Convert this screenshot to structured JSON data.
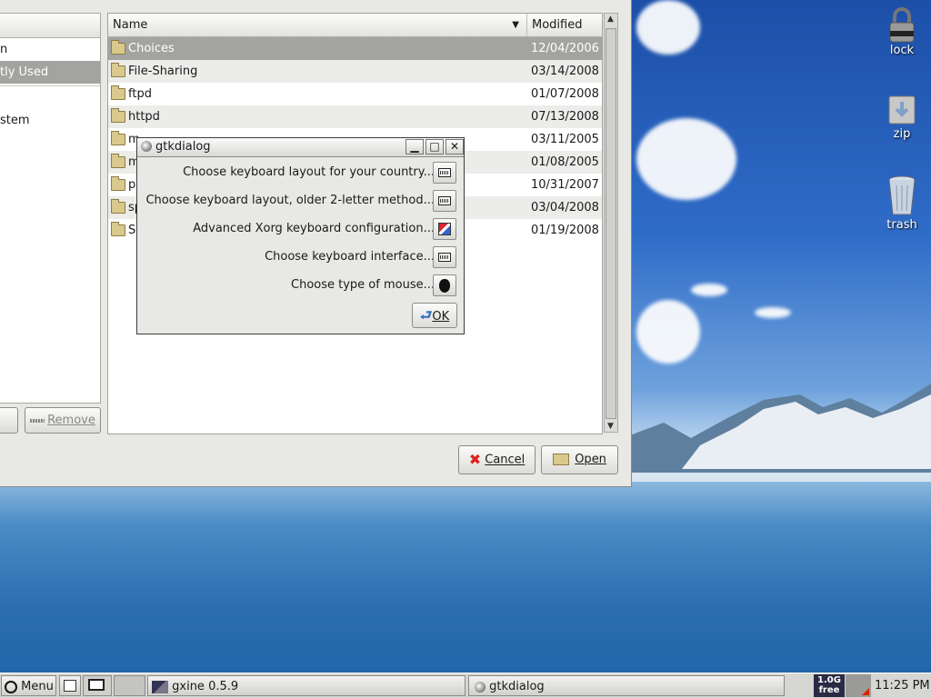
{
  "desktop_icons": [
    {
      "label": "lock",
      "icon": "lock-icon"
    },
    {
      "label": "zip",
      "icon": "zip-icon"
    },
    {
      "label": "trash",
      "icon": "trash-icon"
    }
  ],
  "places": {
    "items": [
      {
        "label": "n"
      },
      {
        "label": "tly Used"
      },
      {
        "label": ""
      },
      {
        "label": "stem"
      }
    ],
    "add_label": "",
    "remove_label": "Remove"
  },
  "filelist": {
    "columns": {
      "name": "Name",
      "modified": "Modified"
    },
    "rows": [
      {
        "name": "Choices",
        "date": "12/04/2006"
      },
      {
        "name": "File-Sharing",
        "date": "03/14/2008"
      },
      {
        "name": "ftpd",
        "date": "01/07/2008"
      },
      {
        "name": "httpd",
        "date": "07/13/2008"
      },
      {
        "name": "m",
        "date": "03/11/2005"
      },
      {
        "name": "m",
        "date": "01/08/2005"
      },
      {
        "name": "p",
        "date": "10/31/2007"
      },
      {
        "name": "sp",
        "date": "03/04/2008"
      },
      {
        "name": "S",
        "date": "01/19/2008"
      }
    ]
  },
  "chooser_buttons": {
    "cancel": "Cancel",
    "open": "Open"
  },
  "dialog": {
    "title": "gtkdialog",
    "options": [
      {
        "label": "Choose keyboard layout for your country...",
        "icon": "keyboard-icon"
      },
      {
        "label": "Choose keyboard layout, older 2-letter method...",
        "icon": "keyboard-icon"
      },
      {
        "label": "Advanced Xorg keyboard configuration...",
        "icon": "xorg-config-icon"
      },
      {
        "label": "Choose keyboard interface...",
        "icon": "keyboard-icon"
      },
      {
        "label": "Choose type of mouse...",
        "icon": "mouse-icon"
      }
    ],
    "ok_label": "OK"
  },
  "taskbar": {
    "menu_label": "Menu",
    "tasks": [
      {
        "label": "gxine 0.5.9"
      },
      {
        "label": "gtkdialog"
      }
    ],
    "disk_free": {
      "line1": "1.0G",
      "line2": "free"
    },
    "clock": "11:25 PM"
  },
  "colors": {
    "selection": "#a3a3a0",
    "dialog_bg": "#e8e8e4",
    "taskbar_bg": "#d6d6d2"
  }
}
